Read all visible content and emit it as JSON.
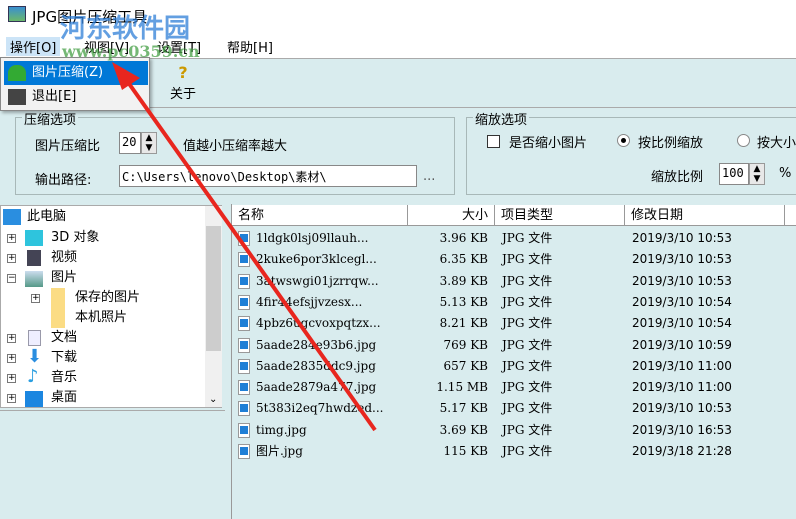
{
  "window": {
    "title": "JPG图片压缩工具"
  },
  "watermark": {
    "name": "河东软件园",
    "url": "www.pc0359.cn"
  },
  "menu": [
    "操作[O]",
    "视图[V]",
    "设置[T]",
    "帮助[H]"
  ],
  "dropdown": [
    "图片压缩(Z)",
    "退出[E]"
  ],
  "toolbar": {
    "about": "关于"
  },
  "compress": {
    "title": "压缩选项",
    "ratio_label": "图片压缩比",
    "ratio_value": "20",
    "ratio_hint": "值越小压缩率越大",
    "output_label": "输出路径:",
    "output_value": "C:\\Users\\lenovo\\Desktop\\素材\\",
    "browse": "..."
  },
  "scale": {
    "title": "缩放选项",
    "shrink_label": "是否缩小图片",
    "by_ratio": "按比例缩放",
    "by_size": "按大小",
    "ratio_label": "缩放比例",
    "ratio_value": "100",
    "unit": "%"
  },
  "tree": {
    "root": "此电脑",
    "items": [
      "3D 对象",
      "视频",
      "图片",
      "保存的图片",
      "本机照片",
      "文档",
      "下载",
      "音乐",
      "桌面"
    ]
  },
  "list": {
    "headers": [
      "名称",
      "大小",
      "项目类型",
      "修改日期"
    ],
    "rows": [
      [
        "1ldgk0lsj09llauh...",
        "3.96 KB",
        "JPG 文件",
        "2019/3/10 10:53"
      ],
      [
        "2kuke6por3klcegl...",
        "6.35 KB",
        "JPG 文件",
        "2019/3/10 10:53"
      ],
      [
        "3atwswgi01jzrrqw...",
        "3.89 KB",
        "JPG 文件",
        "2019/3/10 10:53"
      ],
      [
        "4fir44efsjjvzesx...",
        "5.13 KB",
        "JPG 文件",
        "2019/3/10 10:54"
      ],
      [
        "4pbz6ugcvoxpqtzx...",
        "8.21 KB",
        "JPG 文件",
        "2019/3/10 10:54"
      ],
      [
        "5aade284e93b6.jpg",
        "769 KB",
        "JPG 文件",
        "2019/3/10 10:59"
      ],
      [
        "5aade2835ddc9.jpg",
        "657 KB",
        "JPG 文件",
        "2019/3/10 11:00"
      ],
      [
        "5aade2879a477.jpg",
        "1.15 MB",
        "JPG 文件",
        "2019/3/10 11:00"
      ],
      [
        "5t383i2eq7hwdzed...",
        "5.17 KB",
        "JPG 文件",
        "2019/3/10 10:53"
      ],
      [
        "timg.jpg",
        "3.69 KB",
        "JPG 文件",
        "2019/3/10 16:53"
      ],
      [
        "图片.jpg",
        "115 KB",
        "JPG 文件",
        "2019/3/18 21:28"
      ]
    ]
  }
}
